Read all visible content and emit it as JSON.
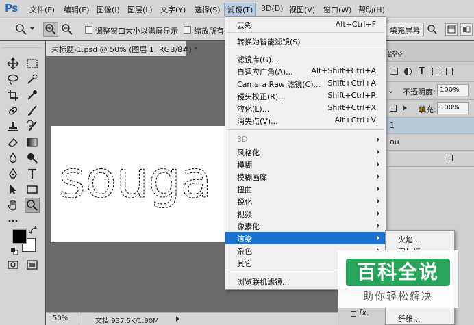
{
  "app": {
    "logo": "Ps"
  },
  "menubar": {
    "items": [
      "文件(F)",
      "编辑(E)",
      "图像(I)",
      "图层(L)",
      "文字(Y)",
      "选择(S)",
      "滤镜(T)",
      "3D(D)",
      "视图(V)",
      "窗口(W)",
      "帮助(H)"
    ]
  },
  "options": {
    "resize_windows": "调整窗口大小以满屏显示",
    "zoom_all": "缩放所有",
    "fill_screen": "填充屏幕"
  },
  "document": {
    "tab_title": "未标题-1.psd @ 50% (图层 1, RGB/8#) *",
    "canvas_text": "souga",
    "zoom": "50%",
    "doc_info": "文档:937.5K/1.90M"
  },
  "panels": {
    "tab_fragment": "路径",
    "opacity_label": "不透明度:",
    "opacity_value": "100%",
    "fill_label": "填充:",
    "fill_value": "100%",
    "layer1": "1",
    "layer2": "ou",
    "fx_label": "fx."
  },
  "filter_menu": {
    "items": [
      {
        "label": "云彩",
        "shortcut": "Alt+Ctrl+F"
      },
      {
        "label": "转换为智能滤镜(S)",
        "shortcut": ""
      },
      {
        "label": "滤镜库(G)...",
        "shortcut": ""
      },
      {
        "label": "自适应广角(A)...",
        "shortcut": "Alt+Shift+Ctrl+A"
      },
      {
        "label": "Camera Raw 滤镜(C)...",
        "shortcut": "Shift+Ctrl+A"
      },
      {
        "label": "镜头校正(R)...",
        "shortcut": "Shift+Ctrl+R"
      },
      {
        "label": "液化(L)...",
        "shortcut": "Shift+Ctrl+X"
      },
      {
        "label": "消失点(V)...",
        "shortcut": "Alt+Ctrl+V"
      },
      {
        "label": "3D",
        "shortcut": ""
      },
      {
        "label": "风格化",
        "shortcut": ""
      },
      {
        "label": "模糊",
        "shortcut": ""
      },
      {
        "label": "模糊画廊",
        "shortcut": ""
      },
      {
        "label": "扭曲",
        "shortcut": ""
      },
      {
        "label": "锐化",
        "shortcut": ""
      },
      {
        "label": "视频",
        "shortcut": ""
      },
      {
        "label": "像素化",
        "shortcut": ""
      },
      {
        "label": "渲染",
        "shortcut": ""
      },
      {
        "label": "杂色",
        "shortcut": ""
      },
      {
        "label": "其它",
        "shortcut": ""
      },
      {
        "label": "浏览联机滤镜...",
        "shortcut": ""
      }
    ]
  },
  "render_submenu": {
    "items": [
      "火焰...",
      "图片框...",
      "纤维..."
    ]
  },
  "watermark": {
    "title": "百科全说",
    "subtitle": "助你轻松解决"
  },
  "colors": {
    "selected": "#1a73d1",
    "watermark_green": "#27a55a",
    "ps_blue": "#1f6fc1"
  }
}
